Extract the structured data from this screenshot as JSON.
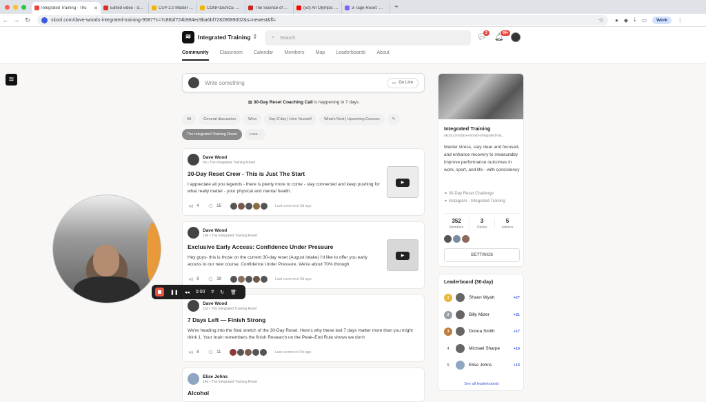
{
  "browser": {
    "tabs": [
      {
        "title": "Integrated Training - Thu",
        "color": "#e5483e",
        "active": true
      },
      {
        "title": "Edited video - dave@wmw.co",
        "color": "#d93025",
        "active": false
      },
      {
        "title": "CUP 2.0 Master - Google Sli",
        "color": "#f4b400",
        "active": false
      },
      {
        "title": "CONFIDENCE SKOOL - Goog",
        "color": "#f4b400",
        "active": false
      },
      {
        "title": "The Science of Nature's Reset",
        "color": "#c62828",
        "active": false
      },
      {
        "title": "(50) An Olympic Gold Medali",
        "color": "#ff0000",
        "active": false
      },
      {
        "title": "3-Tage-Reset: Willkommen",
        "color": "#7b61ff",
        "active": false
      }
    ],
    "url": "skool.com/dave-woods-integrated-training-9587?c=7c86bf724b984ec9ba6bf72828689002&s=newest&fl=",
    "profile": "Work"
  },
  "header": {
    "group_name": "Integrated Training",
    "search_placeholder": "Search",
    "chat_badge": "2",
    "notif_badge": "99+",
    "nav": [
      "Community",
      "Calendar",
      "Members",
      "Map",
      "Leaderboards",
      "About"
    ]
  },
  "feed": {
    "write_placeholder": "Write something",
    "go_live": "Go Live",
    "event_name": "30-Day Reset Coaching Call",
    "event_suffix": " is happening in 7 days",
    "chips": [
      "All",
      "General discussion",
      "Wins",
      "Say G'day | Intro Yourself",
      "What's Next | Upcoming Courses",
      "The Integrated Training Reset",
      "Less..."
    ],
    "posts": [
      {
        "author": "Dave Wood",
        "meta": "6d • The Integrated Training Reset",
        "title": "30-Day Reset Crew - This is Just The Start",
        "body": "I appreciate all you legends - there is plenty more to come - stay connected and keep pushing for what really matter - your physical and mental health.",
        "likes": "4",
        "comments": "15",
        "last": "Last comment 3d ago"
      },
      {
        "author": "Dave Wood",
        "meta": "10d • The Integrated Training Reset",
        "title": "Exclusive Early Access: Confidence Under Pressure",
        "body": "Hey guys- this is those on the current 30-day reset (August intake) I'd like to offer you early access to our new course, Confidence Under Pressure. We're about 70% through",
        "likes": "9",
        "comments": "39",
        "last": "Last comment 3d ago"
      },
      {
        "author": "Dave Wood",
        "meta": "11d • The Integrated Training Reset",
        "title": "7 Days Left — Finish Strong",
        "body": "We're heading into the final stretch of the 30-Day Reset. Here's why these last 7 days matter more than you might think 1. Your brain remembers the finish Research on the Peak–End Rule shows we don't",
        "likes": "8",
        "comments": "11",
        "last": "Last comment 9d ago"
      },
      {
        "author": "Elise Johns",
        "meta": "14d • The Integrated Training Reset",
        "title": "Alcohol"
      }
    ]
  },
  "about_card": {
    "name": "Integrated Training",
    "url": "skool.com/dave-woods-integrated-trai...",
    "description": "Master stress, stay clear and focused, and enhance recovery to measurably improve performance outcomes in work, sport, and life - with consistency",
    "links": [
      "30-Day Reset Challenge",
      "Instagram - Integrated Training"
    ],
    "stats": [
      {
        "n": "352",
        "l": "Members"
      },
      {
        "n": "3",
        "l": "Online"
      },
      {
        "n": "5",
        "l": "Admins"
      }
    ],
    "settings": "SETTINGS"
  },
  "leaderboard": {
    "title": "Leaderboard (30-day)",
    "rows": [
      {
        "rank": "1",
        "name": "Shaun Wyatt",
        "pts": "+27",
        "color": "#e7b83c"
      },
      {
        "rank": "2",
        "name": "Billy Mizer",
        "pts": "+21",
        "color": "#9aa0a6"
      },
      {
        "rank": "3",
        "name": "Donna Smith",
        "pts": "+17",
        "color": "#c17d3c"
      },
      {
        "rank": "4",
        "name": "Michael Sharpe",
        "pts": "+15",
        "color": ""
      },
      {
        "rank": "5",
        "name": "Elise Johns",
        "pts": "+13",
        "color": ""
      }
    ],
    "see_all": "See all leaderboards"
  },
  "recorder": {
    "time": "0:00"
  }
}
